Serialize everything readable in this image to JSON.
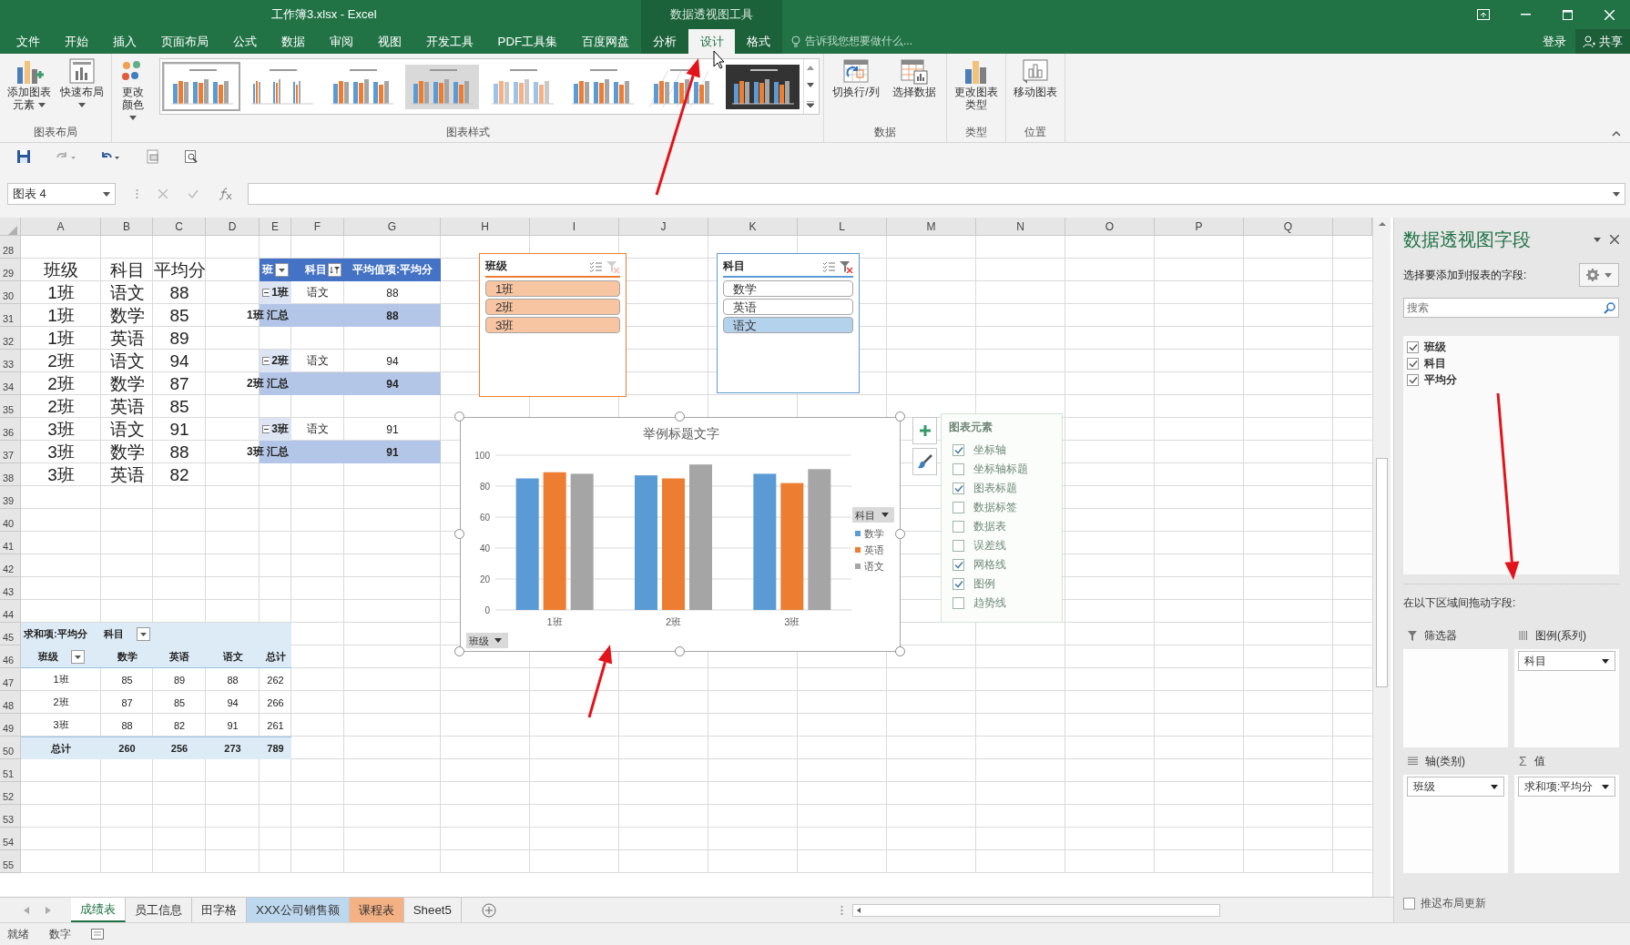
{
  "window": {
    "title": "工作簿3.xlsx - Excel",
    "context_title": "数据透视图工具"
  },
  "ribbon_tabs": [
    {
      "label": "文件",
      "selected": false,
      "contextual": false
    },
    {
      "label": "开始",
      "selected": false,
      "contextual": false
    },
    {
      "label": "插入",
      "selected": false,
      "contextual": false
    },
    {
      "label": "页面布局",
      "selected": false,
      "contextual": false
    },
    {
      "label": "公式",
      "selected": false,
      "contextual": false
    },
    {
      "label": "数据",
      "selected": false,
      "contextual": false
    },
    {
      "label": "审阅",
      "selected": false,
      "contextual": false
    },
    {
      "label": "视图",
      "selected": false,
      "contextual": false
    },
    {
      "label": "开发工具",
      "selected": false,
      "contextual": false
    },
    {
      "label": "PDF工具集",
      "selected": false,
      "contextual": false
    },
    {
      "label": "百度网盘",
      "selected": false,
      "contextual": false
    },
    {
      "label": "分析",
      "selected": false,
      "contextual": true
    },
    {
      "label": "设计",
      "selected": true,
      "contextual": true
    },
    {
      "label": "格式",
      "selected": false,
      "contextual": true
    }
  ],
  "tell_me": {
    "placeholder": "告诉我您想要做什么..."
  },
  "account": {
    "sign_in": "登录",
    "share": "共享"
  },
  "ribbon": {
    "groups": [
      {
        "label": "图表布局",
        "buttons": [
          {
            "label": "添加图表元素",
            "dropdown": true
          },
          {
            "label": "快速布局",
            "dropdown": true
          }
        ]
      },
      {
        "label": "图表样式",
        "buttons": [
          {
            "label": "更改颜色",
            "dropdown": true
          }
        ],
        "gallery": [
          {
            "selected": true,
            "dark": false
          },
          {
            "selected": false,
            "dark": false
          },
          {
            "selected": false,
            "dark": false
          },
          {
            "selected": false,
            "dark": false
          },
          {
            "selected": false,
            "dark": false
          },
          {
            "selected": false,
            "dark": false
          },
          {
            "selected": false,
            "dark": false
          },
          {
            "selected": false,
            "dark": true
          }
        ]
      },
      {
        "label": "数据",
        "buttons": [
          {
            "label": "切换行/列",
            "dropdown": false
          },
          {
            "label": "选择数据",
            "dropdown": false
          }
        ]
      },
      {
        "label": "类型",
        "buttons": [
          {
            "label": "更改图表类型",
            "dropdown": false
          }
        ]
      },
      {
        "label": "位置",
        "buttons": [
          {
            "label": "移动图表",
            "dropdown": false
          }
        ]
      }
    ]
  },
  "name_box": "图表 4",
  "sheet": {
    "columns": [
      "A",
      "B",
      "C",
      "D",
      "E",
      "F",
      "G",
      "H",
      "I",
      "J",
      "K",
      "L",
      "M",
      "N",
      "O",
      "P",
      "Q"
    ],
    "rows": [
      "28",
      "29",
      "30",
      "31",
      "32",
      "33",
      "34",
      "35",
      "36",
      "37",
      "38",
      "39",
      "40",
      "41",
      "42",
      "43",
      "44",
      "45",
      "46",
      "47",
      "48",
      "49",
      "50",
      "51",
      "52",
      "53",
      "54",
      "55"
    ]
  },
  "source_table": {
    "header": [
      "班级",
      "科目",
      "平均分"
    ],
    "rows": [
      [
        "1班",
        "语文",
        "88"
      ],
      [
        "1班",
        "数学",
        "85"
      ],
      [
        "1班",
        "英语",
        "89"
      ],
      [
        "2班",
        "语文",
        "94"
      ],
      [
        "2班",
        "数学",
        "87"
      ],
      [
        "2班",
        "英语",
        "85"
      ],
      [
        "3班",
        "语文",
        "91"
      ],
      [
        "3班",
        "数学",
        "88"
      ],
      [
        "3班",
        "英语",
        "82"
      ]
    ]
  },
  "pivot_table_1": {
    "headers": [
      "班",
      "科目",
      "平均值项:平均分"
    ],
    "groups": [
      {
        "label": "1班",
        "expanded": true,
        "subject": "语文",
        "value": "88",
        "total_label": "1班 汇总",
        "total": "88"
      },
      {
        "label": "2班",
        "expanded": true,
        "subject": "语文",
        "value": "94",
        "total_label": "2班 汇总",
        "total": "94"
      },
      {
        "label": "3班",
        "expanded": true,
        "subject": "语文",
        "value": "91",
        "total_label": "3班 汇总",
        "total": "91"
      }
    ]
  },
  "pivot_table_2": {
    "value_field": "求和项:平均分",
    "column_field": "科目",
    "row_field": "班级",
    "columns": [
      "数学",
      "英语",
      "语文",
      "总计"
    ],
    "rows": [
      {
        "label": "1班",
        "values": [
          "85",
          "89",
          "88",
          "262"
        ]
      },
      {
        "label": "2班",
        "values": [
          "87",
          "85",
          "94",
          "266"
        ]
      },
      {
        "label": "3班",
        "values": [
          "88",
          "82",
          "91",
          "261"
        ]
      }
    ],
    "total": {
      "label": "总计",
      "values": [
        "260",
        "256",
        "273",
        "789"
      ]
    }
  },
  "slicers": [
    {
      "title": "班级",
      "color": "#ed7d31",
      "items": [
        {
          "label": "1班",
          "selected": true
        },
        {
          "label": "2班",
          "selected": true
        },
        {
          "label": "3班",
          "selected": true
        }
      ]
    },
    {
      "title": "科目",
      "color": "#5b9bd5",
      "items": [
        {
          "label": "数学",
          "selected": false
        },
        {
          "label": "英语",
          "selected": false
        },
        {
          "label": "语文",
          "selected": true
        }
      ]
    }
  ],
  "chart": {
    "legend_field": "科目",
    "axis_field": "班级",
    "chart_data": {
      "type": "bar",
      "title": "举例标题文字",
      "categories": [
        "1班",
        "2班",
        "3班"
      ],
      "series": [
        {
          "name": "数学",
          "color": "#5b9bd5",
          "values": [
            85,
            87,
            88
          ]
        },
        {
          "name": "英语",
          "color": "#ed7d31",
          "values": [
            89,
            85,
            82
          ]
        },
        {
          "name": "语文",
          "color": "#a5a5a5",
          "values": [
            88,
            94,
            91
          ]
        }
      ],
      "ylim": [
        0,
        100
      ],
      "yticks": [
        0,
        20,
        40,
        60,
        80,
        100
      ],
      "grid": true,
      "legend": true
    }
  },
  "chart_elements": {
    "title": "图表元素",
    "items": [
      {
        "label": "坐标轴",
        "checked": true
      },
      {
        "label": "坐标轴标题",
        "checked": false
      },
      {
        "label": "图表标题",
        "checked": true
      },
      {
        "label": "数据标签",
        "checked": false
      },
      {
        "label": "数据表",
        "checked": false
      },
      {
        "label": "误差线",
        "checked": false
      },
      {
        "label": "网格线",
        "checked": true
      },
      {
        "label": "图例",
        "checked": true
      },
      {
        "label": "趋势线",
        "checked": false
      }
    ]
  },
  "sheet_tabs": [
    {
      "label": "成绩表",
      "selected": true
    },
    {
      "label": "员工信息",
      "selected": false
    },
    {
      "label": "田字格",
      "selected": false
    },
    {
      "label": "XXX公司销售额",
      "selected": false,
      "color": "#bdd7ee"
    },
    {
      "label": "课程表",
      "selected": false,
      "color": "#f4b183"
    },
    {
      "label": "Sheet5",
      "selected": false
    }
  ],
  "status_bar": {
    "items": [
      "就绪",
      "数字"
    ]
  },
  "field_pane": {
    "title": "数据透视图字段",
    "subtitle": "选择要添加到报表的字段:",
    "search": {
      "placeholder": "搜索"
    },
    "fields": [
      {
        "label": "班级",
        "checked": true
      },
      {
        "label": "科目",
        "checked": true
      },
      {
        "label": "平均分",
        "checked": true
      }
    ],
    "areas_label": "在以下区域间拖动字段:",
    "areas": [
      {
        "kind": "filter",
        "label": "筛选器"
      },
      {
        "kind": "legend",
        "label": "图例(系列)",
        "fields": [
          "科目"
        ]
      },
      {
        "kind": "axis",
        "label": "轴(类别)",
        "fields": [
          "班级"
        ]
      },
      {
        "kind": "values",
        "symbol": "Σ",
        "label": "值",
        "fields": [
          "求和项:平均分"
        ]
      }
    ],
    "defer": {
      "label": "推迟布局更新",
      "checked": false
    }
  }
}
